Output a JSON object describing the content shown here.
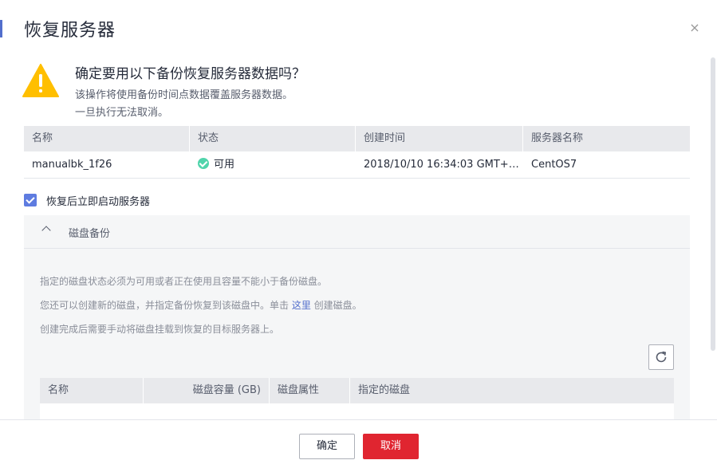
{
  "dialog": {
    "title": "恢复服务器",
    "close_icon": "×"
  },
  "warning": {
    "icon": "warning-triangle-icon",
    "title": "确定要用以下备份恢复服务器数据吗？",
    "line1": "该操作将使用备份时间点数据覆盖服务器数据。",
    "line2": "一旦执行无法取消。"
  },
  "backup_table": {
    "columns": [
      "名称",
      "状态",
      "创建时间",
      "服务器名称"
    ],
    "rows": [
      {
        "name": "manualbk_1f26",
        "status": "可用",
        "created": "2018/10/10 16:34:03 GMT+…",
        "server": "CentOS7"
      }
    ]
  },
  "start_after_restore": {
    "label": "恢复后立即启动服务器",
    "checked": true
  },
  "disk_backup": {
    "title": "磁盘备份",
    "note1": "指定的磁盘状态必须为可用或者正在使用且容量不能小于备份磁盘。",
    "note2_prefix": "您还可以创建新的磁盘，并指定备份恢复到该磁盘中。单击 ",
    "note2_link": "这里",
    "note2_suffix": " 创建磁盘。",
    "note3": "创建完成后需要手动将磁盘挂载到恢复的目标服务器上。",
    "columns": [
      "名称",
      "磁盘容量 (GB)",
      "磁盘属性",
      "指定的磁盘"
    ]
  },
  "footer": {
    "ok_label": "确定",
    "cancel_label": "取消"
  },
  "colors": {
    "accent": "#526ecc",
    "danger": "#e02530",
    "warning": "#ffbf00",
    "success": "#50d4ab"
  }
}
